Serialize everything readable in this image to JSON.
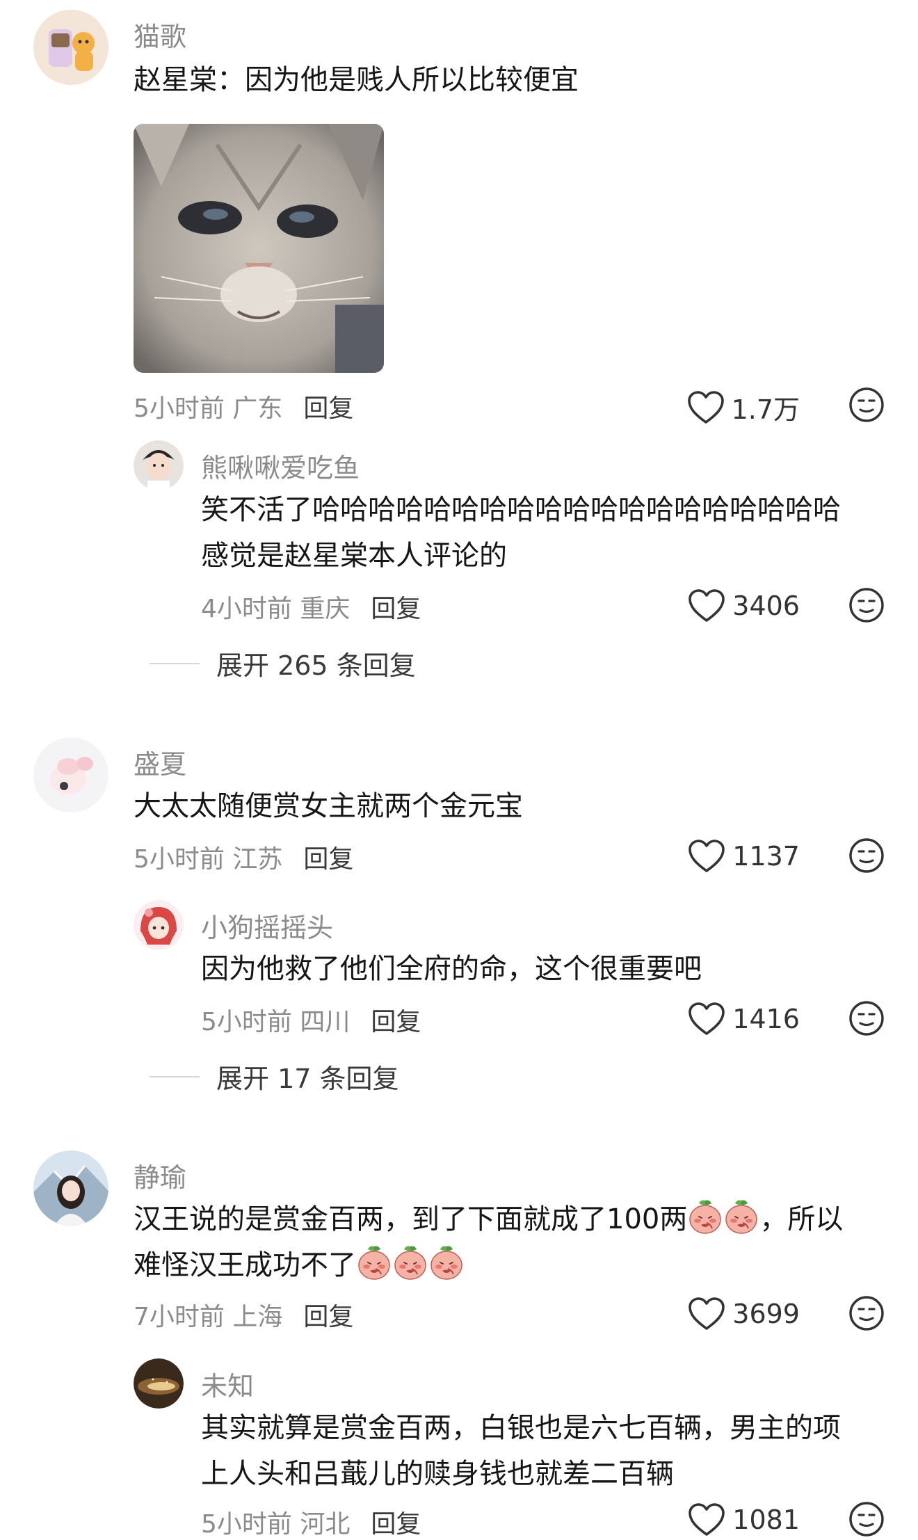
{
  "comments": [
    {
      "username": "猫歌",
      "text": "赵星棠：因为他是贱人所以比较便宜",
      "meta": "5小时前 广东",
      "reply_label": "回复",
      "likes": "1.7万",
      "replies": [
        {
          "username": "熊啾啾爱吃鱼",
          "lines": [
            "笑不活了哈哈哈哈哈哈哈哈哈哈哈哈哈哈哈哈哈哈哈",
            "感觉是赵星棠本人评论的"
          ],
          "meta": "4小时前 重庆",
          "reply_label": "回复",
          "likes": "3406"
        }
      ],
      "expand": "展开 265 条回复"
    },
    {
      "username": "盛夏",
      "text": "大太太随便赏女主就两个金元宝",
      "meta": "5小时前 江苏",
      "reply_label": "回复",
      "likes": "1137",
      "replies": [
        {
          "username": "小狗摇摇头",
          "lines": [
            "因为他救了他们全府的命，这个很重要吧"
          ],
          "meta": "5小时前 四川",
          "reply_label": "回复",
          "likes": "1416"
        }
      ],
      "expand": "展开 17 条回复"
    },
    {
      "username": "静瑜",
      "line1_a": "汉王说的是赏金百两，到了下面就成了100两",
      "line1_b": "，所以",
      "line2": "难怪汉王成功不了",
      "meta": "7小时前 上海",
      "reply_label": "回复",
      "likes": "3699",
      "replies": [
        {
          "username": "未知",
          "lines": [
            "其实就算是赏金百两，白银也是六七百辆，男主的项",
            "上人头和吕蕺儿的赎身钱也就差二百辆"
          ],
          "meta": "5小时前 河北",
          "reply_label": "回复",
          "likes": "1081"
        }
      ]
    }
  ],
  "icons": {
    "like": "heart-outline-icon",
    "emoji": "emoji-face-icon",
    "peach": "peach-emoji-icon"
  }
}
